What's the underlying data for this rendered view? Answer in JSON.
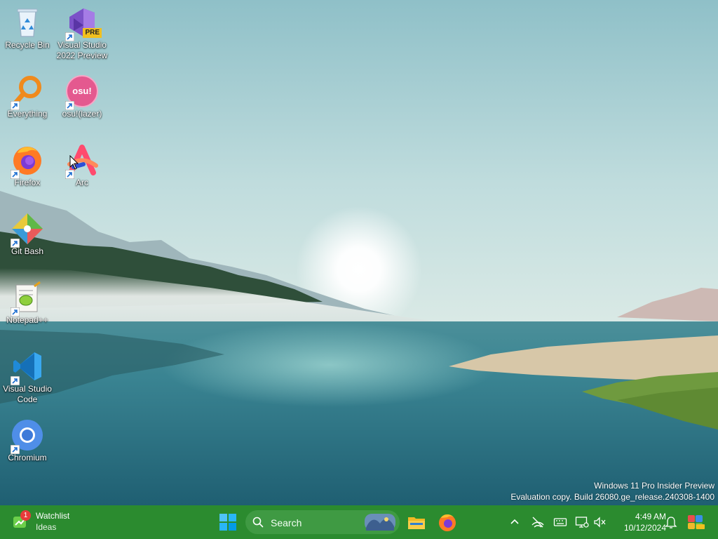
{
  "desktop": {
    "icons": [
      {
        "label": "Recycle Bin"
      },
      {
        "label": "Visual Studio 2022 Preview",
        "badge": "PRE"
      },
      {
        "label": "Everything"
      },
      {
        "label": "osu!(lazer)",
        "glyph": "osu!"
      },
      {
        "label": "Firefox"
      },
      {
        "label": "Arc"
      },
      {
        "label": "Git Bash"
      },
      {
        "label": "Notepad++"
      },
      {
        "label": "Visual Studio Code"
      },
      {
        "label": "Chromium"
      }
    ]
  },
  "watermark": {
    "line1": "Windows 11 Pro Insider Preview",
    "line2": "Evaluation copy. Build 26080.ge_release.240308-1400"
  },
  "taskbar": {
    "widgets": {
      "title": "Watchlist",
      "subtitle": "Ideas",
      "badge": "1"
    },
    "search": {
      "label": "Search"
    },
    "clock": {
      "time": "4:49 AM",
      "date": "10/12/2024"
    }
  },
  "colors": {
    "taskbar": "#2b8b2f",
    "search_box": "#3f9a43",
    "badge_red": "#e83a3a"
  }
}
